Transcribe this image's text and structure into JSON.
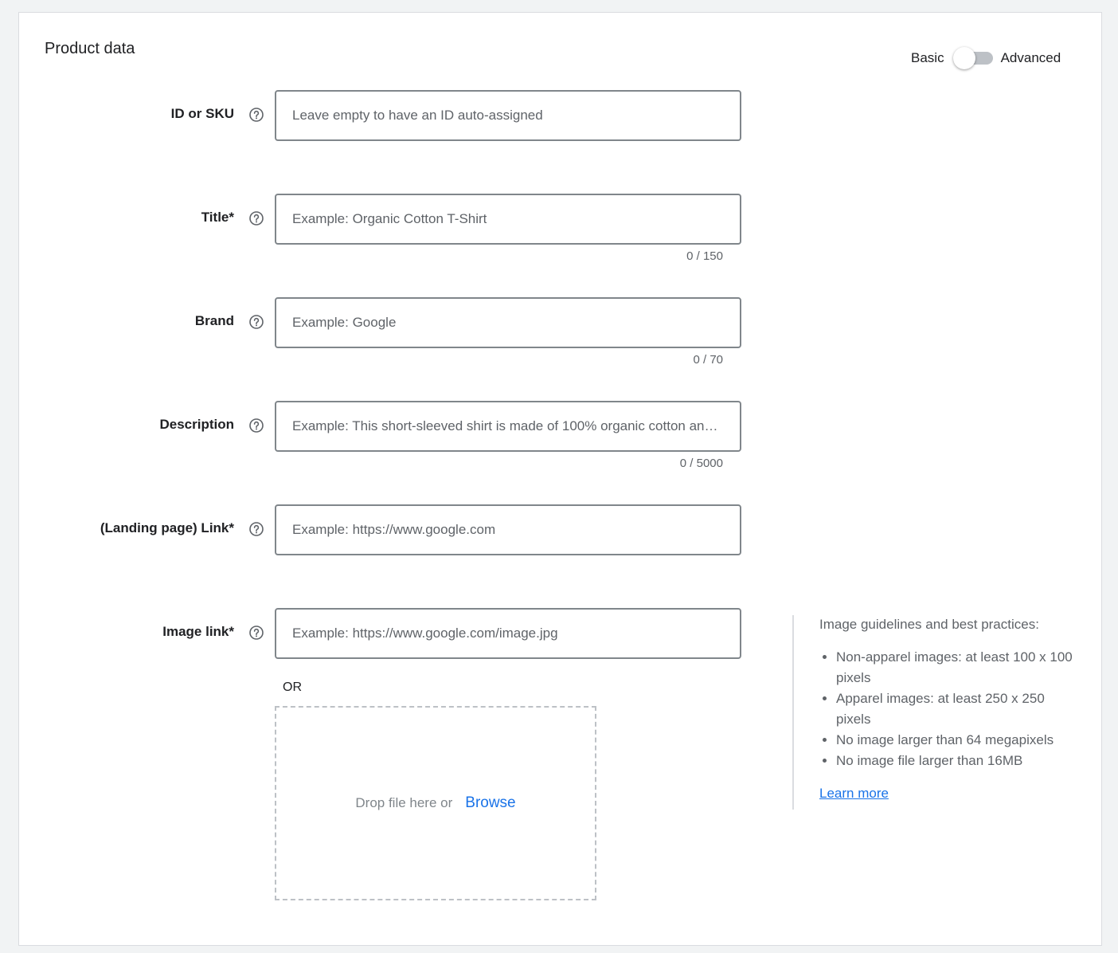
{
  "card": {
    "title": "Product data"
  },
  "mode_toggle": {
    "left_label": "Basic",
    "right_label": "Advanced",
    "state": "Basic"
  },
  "fields": {
    "id": {
      "label": "ID or SKU",
      "placeholder": "Leave empty to have an ID auto-assigned",
      "value": ""
    },
    "title": {
      "label": "Title*",
      "placeholder": "Example: Organic Cotton T-Shirt",
      "value": "",
      "counter": "0 / 150"
    },
    "brand": {
      "label": "Brand",
      "placeholder": "Example: Google",
      "value": "",
      "counter": "0 / 70"
    },
    "description": {
      "label": "Description",
      "placeholder": "Example: This short-sleeved shirt is made of 100% organic cotton an…",
      "value": "",
      "counter": "0 / 5000"
    },
    "link": {
      "label": "(Landing page) Link*",
      "placeholder": "Example: https://www.google.com",
      "value": ""
    },
    "image_link": {
      "label": "Image link*",
      "placeholder": "Example: https://www.google.com/image.jpg",
      "value": ""
    }
  },
  "upload": {
    "or_label": "OR",
    "drop_text": "Drop file here or",
    "browse_label": "Browse"
  },
  "guidelines": {
    "title": "Image guidelines and best practices:",
    "items": [
      "Non-apparel images: at least 100 x 100 pixels",
      "Apparel images: at least 250 x 250 pixels",
      "No image larger than 64 megapixels",
      "No image file larger than 16MB"
    ],
    "learn_more": "Learn more"
  },
  "icons": {
    "help": "help-circle-icon"
  },
  "colors": {
    "accent": "#1a73e8",
    "border": "#80868b",
    "muted_text": "#5f6368"
  }
}
